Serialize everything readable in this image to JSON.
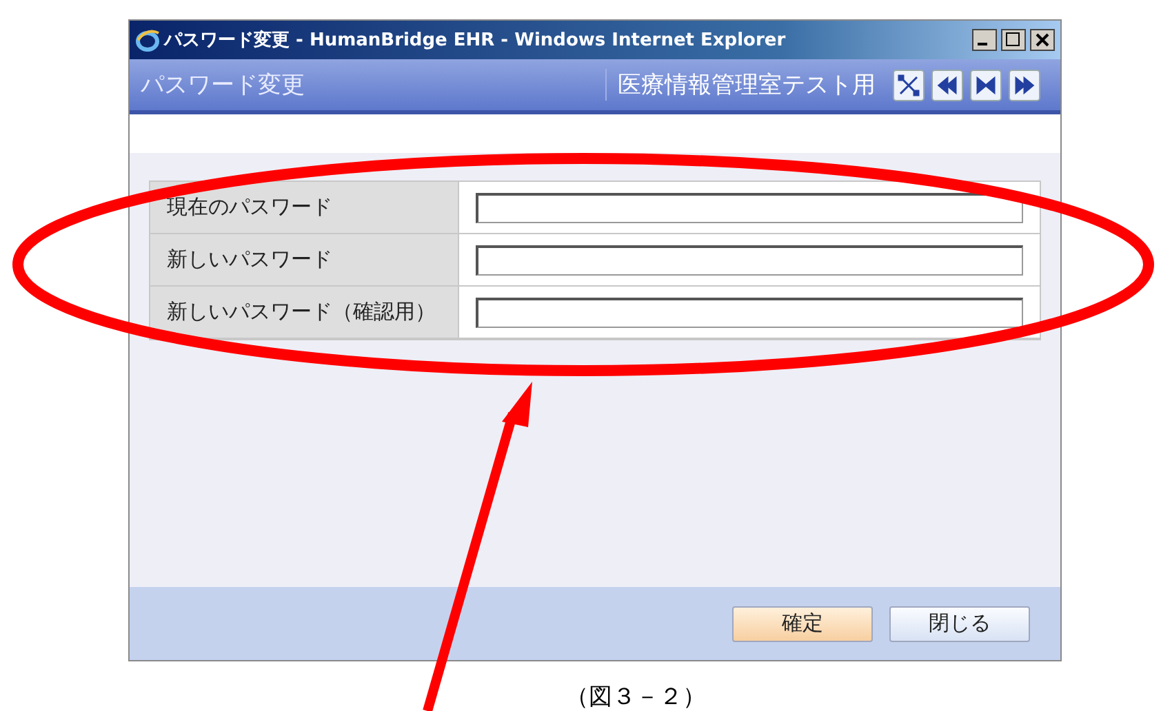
{
  "window": {
    "title": "パスワード変更 - HumanBridge EHR - Windows Internet Explorer"
  },
  "header": {
    "title": "パスワード変更",
    "user": "医療情報管理室テスト用"
  },
  "form": {
    "rows": [
      {
        "label": "現在のパスワード"
      },
      {
        "label": "新しいパスワード"
      },
      {
        "label": "新しいパスワード（確認用）"
      }
    ]
  },
  "buttons": [
    {
      "label": "確定",
      "default": true
    },
    {
      "label": "閉じる",
      "default": false
    }
  ],
  "caption": "（図３－２）"
}
